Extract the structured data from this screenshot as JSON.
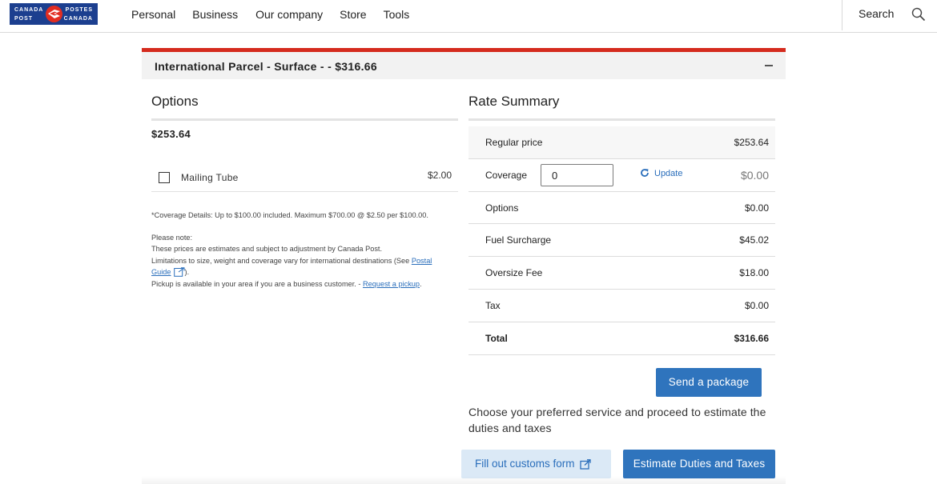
{
  "header": {
    "logo": {
      "text_tl": "CANADA",
      "text_bl": "POST",
      "text_tr": "POSTES",
      "text_br": "CANADA"
    },
    "nav": [
      {
        "label": "Personal"
      },
      {
        "label": "Business"
      },
      {
        "label": "Our company"
      },
      {
        "label": "Store"
      },
      {
        "label": "Tools"
      }
    ],
    "search_label": "Search",
    "search_icon": "search-icon"
  },
  "section": {
    "title": "International Parcel - Surface - - $316.66",
    "collapse_icon": "minus-icon",
    "accent_color": "#d52b1e"
  },
  "options": {
    "heading": "Options",
    "base_price": "$253.64",
    "items": [
      {
        "label": "Mailing Tube",
        "price": "$2.00",
        "checked": false
      }
    ],
    "coverage_note": "*Coverage Details: Up to $100.00 included. Maximum $700.00 @ $2.50 per $100.00.",
    "please_note": "Please note:",
    "note_estimates": "These prices are estimates and subject to adjustment by Canada Post.",
    "note_limits_prefix": "Limitations to size, weight and coverage vary for international destinations (See ",
    "note_limits_link_1": "Postal",
    "note_limits_link_2": "Guide",
    "note_limits_suffix": ").",
    "note_pickup_prefix": "Pickup is available in your area if you are a business customer. - ",
    "note_pickup_link": "Request a pickup",
    "note_pickup_suffix": "."
  },
  "rate_summary": {
    "heading": "Rate Summary",
    "regular_price": {
      "label": "Regular price",
      "value": "$253.64"
    },
    "coverage": {
      "label": "Coverage",
      "input_value": "0",
      "update_label": "Update",
      "value": "$0.00"
    },
    "rows": [
      {
        "label": "Options",
        "value": "$0.00"
      },
      {
        "label": "Fuel Surcharge",
        "value": "$45.02"
      },
      {
        "label": "Oversize Fee",
        "value": "$18.00"
      },
      {
        "label": "Tax",
        "value": "$0.00"
      }
    ],
    "total": {
      "label": "Total",
      "value": "$316.66"
    }
  },
  "actions": {
    "send_package": "Send a package",
    "hint": "Choose your preferred service and proceed to estimate the duties and taxes",
    "customs_form": "Fill out customs form",
    "estimate_duties": "Estimate Duties and Taxes",
    "primary_color": "#2f74bd"
  }
}
